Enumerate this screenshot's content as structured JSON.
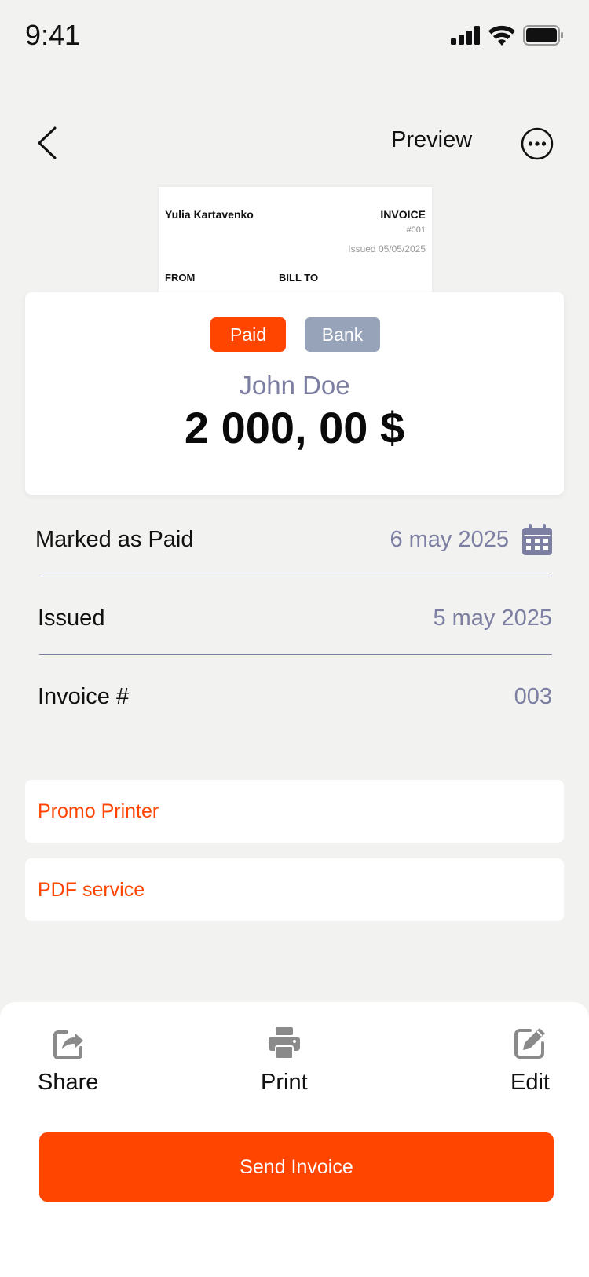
{
  "status_bar": {
    "time": "9:41"
  },
  "nav": {
    "title": "Preview"
  },
  "invoice_preview": {
    "name": "Yulia Kartavenko",
    "doc_title": "INVOICE",
    "number": "#001",
    "issued": "Issued 05/05/2025",
    "from_label": "FROM",
    "bill_to_label": "BILL TO"
  },
  "summary": {
    "status_badge": "Paid",
    "method_badge": "Bank",
    "client": "John Doe",
    "amount": "2 000, 00 $"
  },
  "details": [
    {
      "label": "Marked as Paid",
      "value": "6 may 2025"
    },
    {
      "label": "Issued",
      "value": "5 may 2025"
    },
    {
      "label": "Invoice #",
      "value": "003"
    }
  ],
  "services": [
    {
      "label": "Promo Printer"
    },
    {
      "label": "PDF service"
    }
  ],
  "actions": {
    "share": "Share",
    "print": "Print",
    "edit": "Edit",
    "send": "Send Invoice"
  },
  "colors": {
    "accent": "#ff4500",
    "muted": "#7d7fa2",
    "badge_bank": "#97a3b8",
    "background": "#f2f2f1"
  }
}
